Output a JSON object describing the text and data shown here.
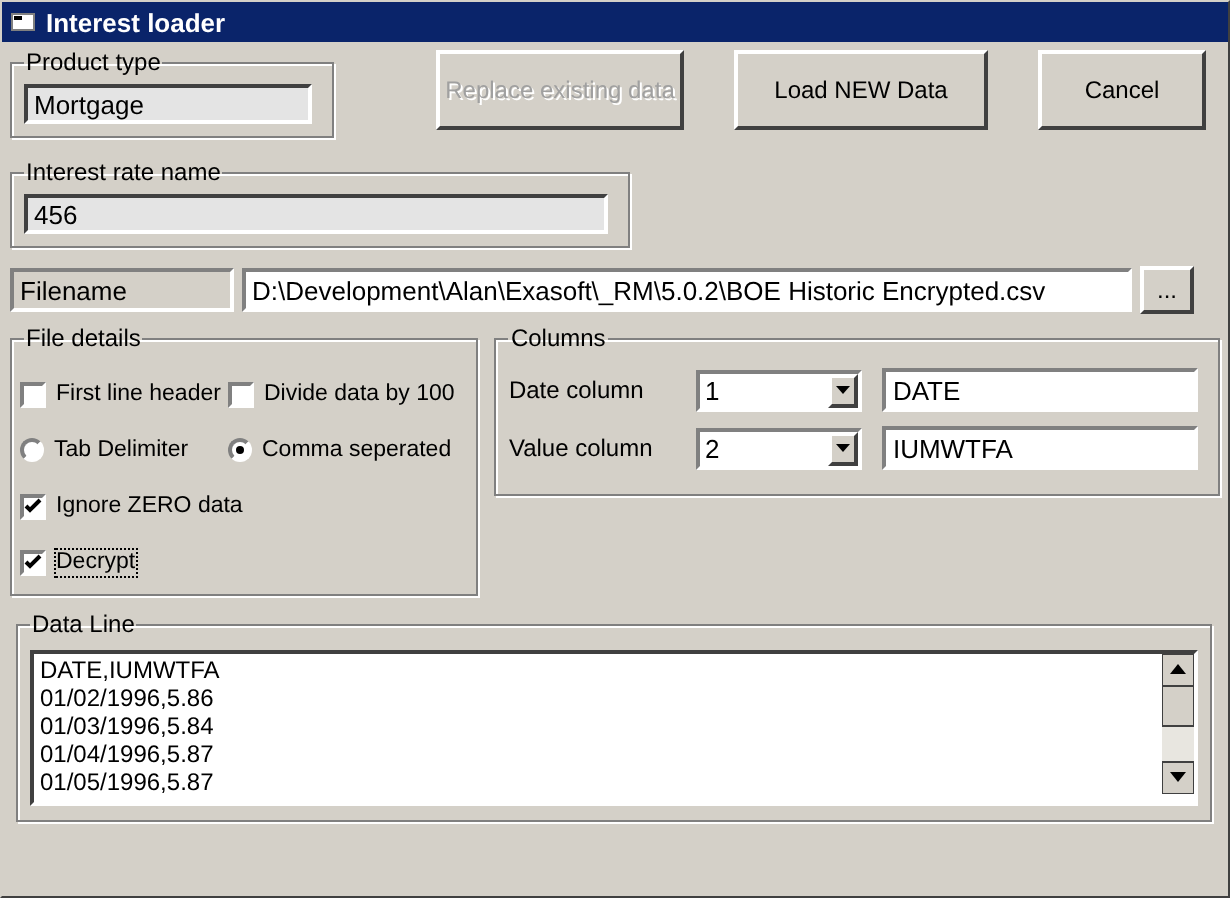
{
  "window": {
    "title": "Interest loader"
  },
  "product_type": {
    "label": "Product type",
    "value": "Mortgage"
  },
  "buttons": [
    {
      "label": "Replace existing data",
      "disabled": true
    },
    {
      "label": "Load NEW Data",
      "disabled": false
    },
    {
      "label": "Cancel",
      "disabled": false
    }
  ],
  "interest_rate_name": {
    "label": "Interest rate name",
    "value": "456"
  },
  "filename": {
    "label": "Filename",
    "value": "D:\\Development\\Alan\\Exasoft\\_RM\\5.0.2\\BOE Historic Encrypted.csv",
    "browse": "..."
  },
  "file_details": {
    "label": "File details",
    "options": [
      {
        "kind": "checkbox",
        "label": "First line header",
        "checked": false,
        "focused": false
      },
      {
        "kind": "checkbox",
        "label": "Divide data by 100",
        "checked": false,
        "focused": false
      },
      {
        "kind": "radio",
        "label": "Tab Delimiter",
        "selected": false,
        "focused": false
      },
      {
        "kind": "radio",
        "label": "Comma seperated",
        "selected": true,
        "focused": false
      },
      {
        "kind": "checkbox",
        "label": "Ignore ZERO data",
        "checked": true,
        "focused": false
      },
      {
        "kind": "checkbox",
        "label": "Decrypt",
        "checked": true,
        "focused": true
      }
    ]
  },
  "columns": {
    "label": "Columns",
    "rows": [
      {
        "label": "Date column",
        "index": "1",
        "name": "DATE"
      },
      {
        "label": "Value column",
        "index": "2",
        "name": "IUMWTFA"
      }
    ]
  },
  "data_line": {
    "label": "Data Line",
    "lines": [
      "DATE,IUMWTFA",
      "01/02/1996,5.86",
      "01/03/1996,5.84",
      "01/04/1996,5.87",
      "01/05/1996,5.87"
    ]
  }
}
